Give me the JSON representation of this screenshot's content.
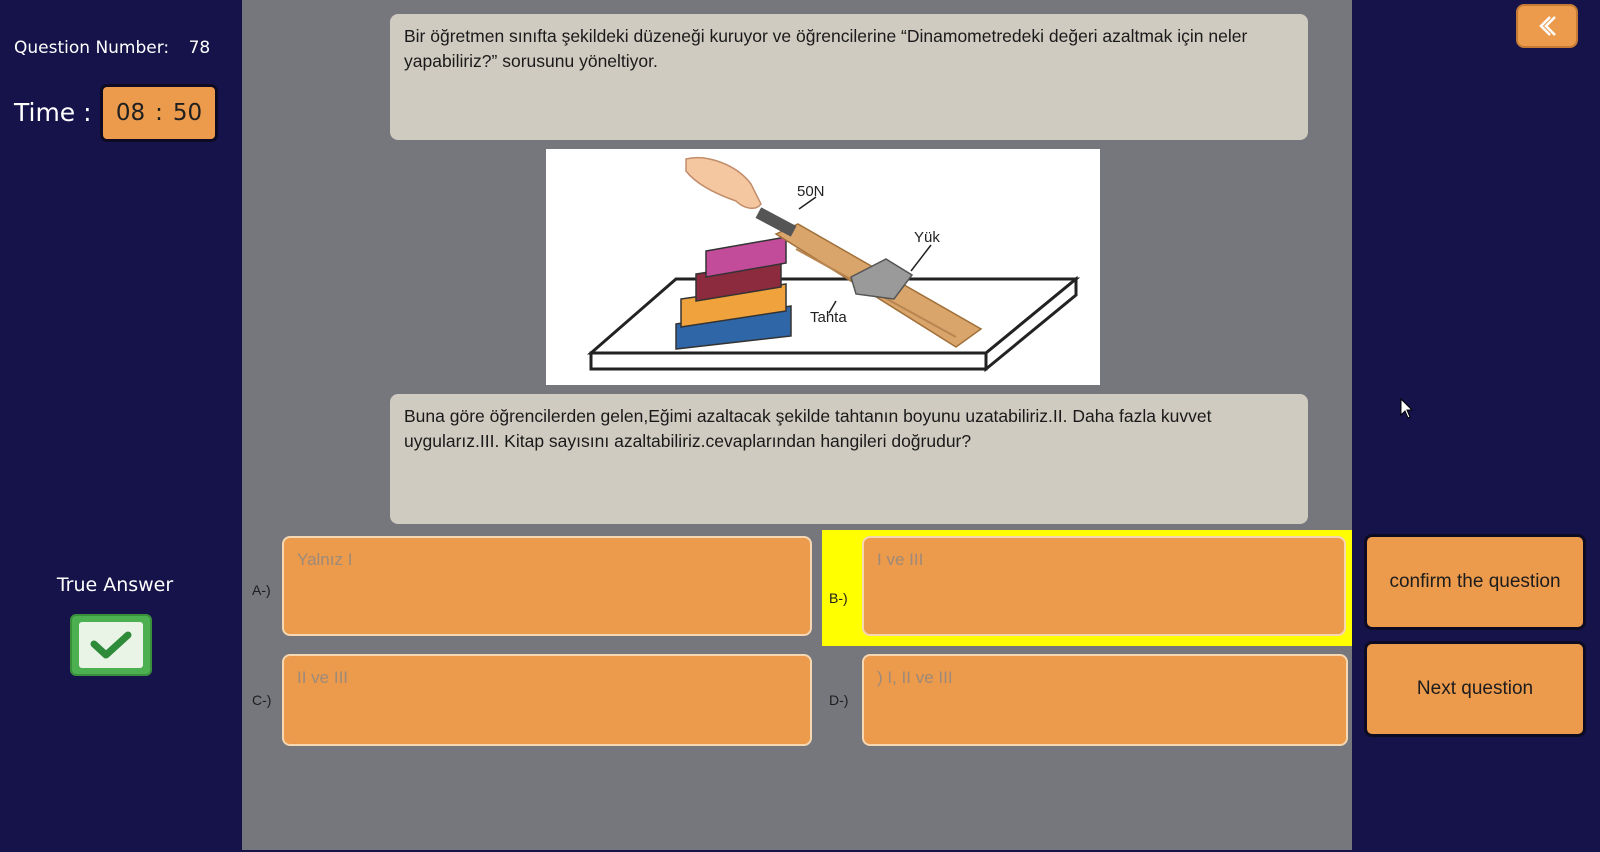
{
  "left": {
    "question_number_label": "Question Number:",
    "question_number_value": "78",
    "time_label": "Time :",
    "timer_minutes": "08",
    "timer_sep": ":",
    "timer_seconds": "50",
    "true_answer_label": "True Answer",
    "true_answer_icon": "check-icon"
  },
  "question": {
    "intro_text": "Bir öğretmen sınıfta şekildeki düzeneği kuruyor ve öğrencilerine “Dinamometredeki değeri azaltmak için neler yapabiliriz?” sorusunu yöneltiyor.",
    "body_text": "Buna göre öğrencilerden gelen,Eğimi azaltacak şekilde tahtanın boyunu uzatabiliriz.II.             Daha fazla kuvvet uygularız.III.   Kitap sayısını azaltabiliriz.cevaplarından hangileri doğrudur?",
    "figure_labels": {
      "force": "50N",
      "load": "Yük",
      "board": "Tahta"
    }
  },
  "options": [
    {
      "prefix": "A-)",
      "text": "Yalnız I",
      "selected": false
    },
    {
      "prefix": "B-)",
      "text": "I ve III",
      "selected": true
    },
    {
      "prefix": "C-)",
      "text": "II ve III",
      "selected": false
    },
    {
      "prefix": "D-)",
      "text": ") I, II ve III",
      "selected": false
    }
  ],
  "buttons": {
    "confirm": "confirm the question",
    "next": "Next question",
    "back_icon": "chevron-left-icon"
  },
  "colors": {
    "background": "#15134a",
    "main_panel": "#76777d",
    "accent_orange": "#ec9a4c",
    "selected_highlight": "#ffff00",
    "text_box": "#d0cbc1"
  }
}
